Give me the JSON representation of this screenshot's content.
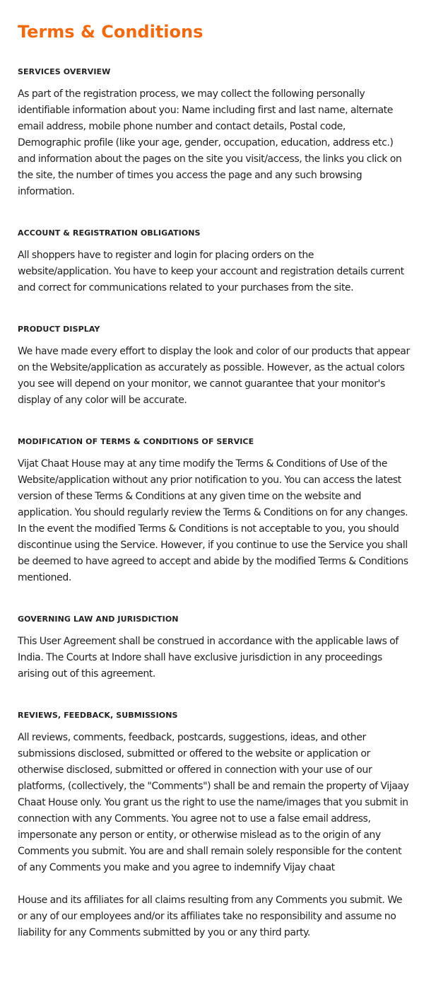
{
  "page": {
    "title": "Terms & Conditions"
  },
  "sections": [
    {
      "heading": "SERVICES OVERVIEW",
      "body": "As part of the registration process, we may collect the following personally identifiable information about you: Name including first and last name, alternate email address, mobile phone number and contact details, Postal code, Demographic profile (like your age, gender, occupation, education, address etc.) and information about the pages on the site you visit/access, the links you click on the site, the number of times you access the page and any such browsing information."
    },
    {
      "heading": "ACCOUNT & REGISTRATION OBLIGATIONS",
      "body": "All shoppers have to register and login for placing orders on the website/application. You have to keep your account and registration details current and correct for communications related to your purchases from the site."
    },
    {
      "heading": "PRODUCT DISPLAY",
      "body": "We have made every effort to display the look and color of our products that appear on the Website/application as accurately as possible. However, as the actual colors you see will depend on your monitor, we cannot guarantee that your monitor's display of any color will be accurate."
    },
    {
      "heading": "MODIFICATION OF TERMS & CONDITIONS OF SERVICE",
      "body": "Vijat Chaat House may at any time modify the Terms & Conditions of Use of the Website/application without any prior notification to you. You can access the latest version of these Terms & Conditions at any given time on the website and application. You should regularly review the Terms & Conditions on for any changes. In the event the modified Terms & Conditions is not acceptable to you, you should discontinue using the Service. However, if you continue to use the Service you shall be deemed to have agreed to accept and abide by the modified Terms & Conditions mentioned."
    },
    {
      "heading": "GOVERNING LAW AND JURISDICTION",
      "body": "This User Agreement shall be construed in accordance with the applicable laws of India. The Courts at Indore shall have exclusive jurisdiction in any proceedings arising out of this agreement."
    },
    {
      "heading": "REVIEWS, FEEDBACK, SUBMISSIONS",
      "body": "All reviews, comments, feedback, postcards, suggestions, ideas, and other submissions disclosed, submitted or offered to the website or application or otherwise disclosed, submitted or offered in connection with your use of our platforms, (collectively, the \"Comments\") shall be and remain the property of Vijaay Chaat House only. You grant us the right to use the name/images that you submit in connection with any Comments. You agree not to use a false email address, impersonate any person or entity, or otherwise mislead as to the origin of any Comments you submit. You are and shall remain solely responsible for the content of any Comments you make and you agree to indemnify Vijay chaat",
      "extra": "House and its affiliates for all claims resulting from any Comments you submit. We or any of our employees and/or its affiliates take no responsibility and assume no liability for any Comments submitted by you or any third party."
    }
  ]
}
